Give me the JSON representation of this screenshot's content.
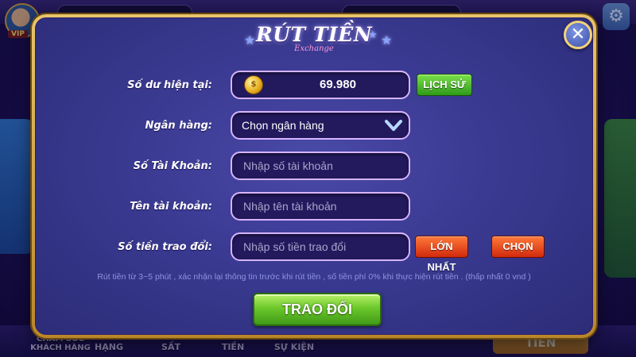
{
  "background": {
    "vip_label": "VIP",
    "tien_button": "TIỀN",
    "bottom_nav": [
      "CHĂM SÓC KHÁCH HÀNG",
      "HẠNG",
      "SẤT",
      "TIỀN",
      "SỰ KIỆN"
    ]
  },
  "modal": {
    "title": "RÚT TIỀN",
    "subtitle": "Exchange",
    "close_icon": "close-icon",
    "balance": {
      "label": "Số dư hiện tại:",
      "value": "69.980",
      "history_button": "LỊCH SỬ"
    },
    "bank": {
      "label": "Ngân hàng:",
      "selected": "Chọn ngân hàng"
    },
    "account_number": {
      "label": "Số Tài Khoản:",
      "placeholder": "Nhập số tài khoản",
      "value": ""
    },
    "account_name": {
      "label": "Tên tài khoản:",
      "placeholder": "Nhập tên tài khoản",
      "value": ""
    },
    "amount": {
      "label": "Số tiền trao đổi:",
      "placeholder": "Nhập số tiền trao đổi",
      "value": "",
      "max_button": "LỚN NHẤT",
      "choose_button": "CHỌN"
    },
    "note": "Rút tiền từ 3~5 phút , xác nhận lại thông tin trước khi rút tiền , số tiền phí 0% khi thực hiện rút tiền . (thấp nhất 0 vnd )",
    "submit_button": "TRAO ĐỔI"
  },
  "colors": {
    "modal_frame": "#d9a63a",
    "panel": "#3a3a92",
    "field_border": "#d7b4ff",
    "green_button": "#4fb820",
    "orange_button": "#e8441a",
    "note_text": "#8f94e0"
  }
}
